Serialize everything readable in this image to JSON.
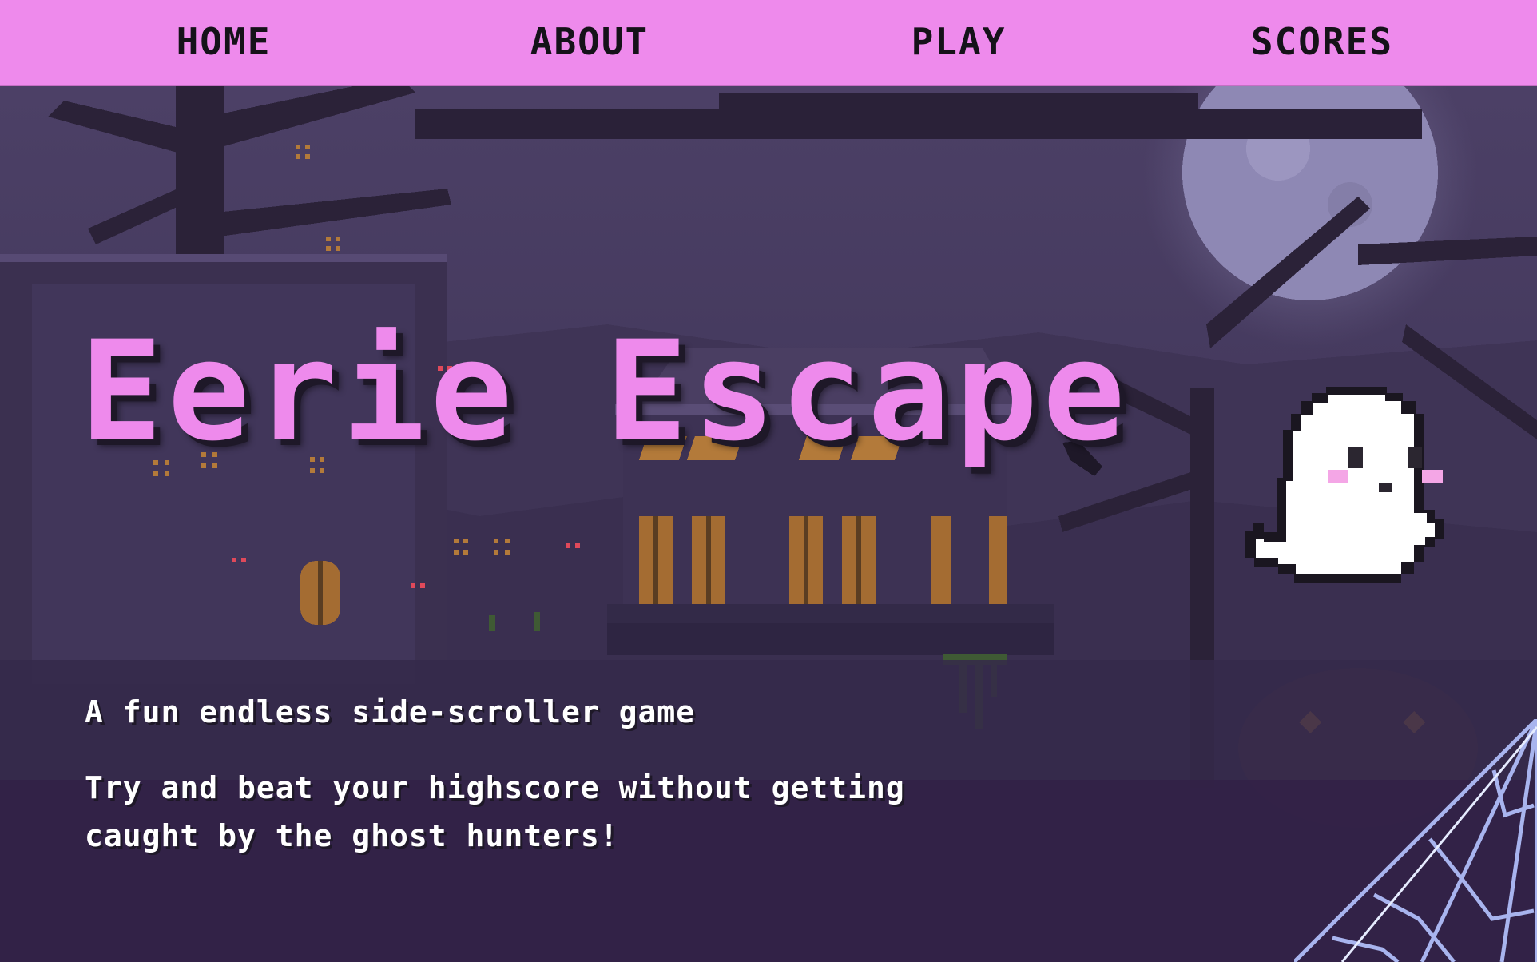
{
  "nav": {
    "home": "HOME",
    "about": "ABOUT",
    "play": "PLAY",
    "scores": "SCORES"
  },
  "hero": {
    "title": "Eerie Escape",
    "tagline": "A fun endless side-scroller game",
    "description": "Try and beat your highscore without getting caught by the ghost hunters!"
  },
  "colors": {
    "accent": "#ee8aec",
    "nav_text": "#151219",
    "background": "#2d2440",
    "text": "#ffffff"
  },
  "icons": {
    "mascot": "ghost-icon",
    "decor_corner": "spider-web-icon"
  }
}
